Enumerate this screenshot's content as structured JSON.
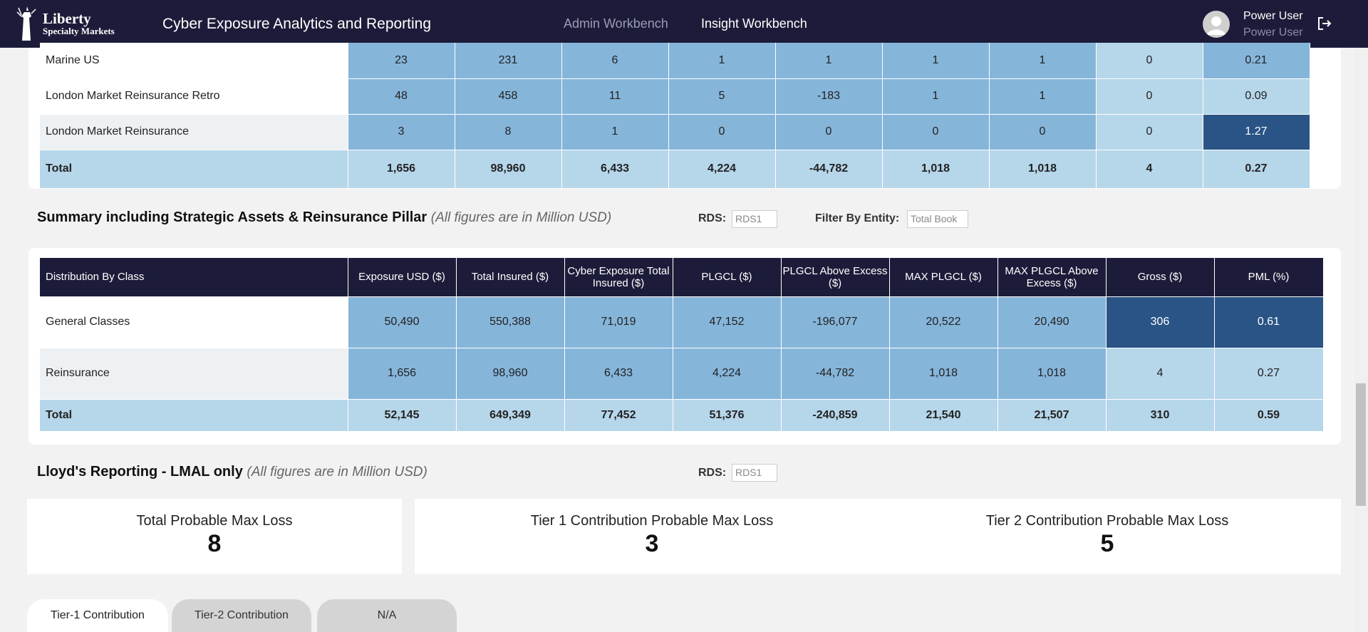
{
  "header": {
    "logo_line1": "Liberty",
    "logo_line2": "Specialty Markets",
    "app_title": "Cyber Exposure Analytics and Reporting",
    "nav": {
      "admin": "Admin Workbench",
      "insight": "Insight Workbench"
    },
    "user_name": "Power User",
    "user_role": "Power User"
  },
  "table1": {
    "rows": [
      {
        "label": "Marine US",
        "values": [
          "23",
          "231",
          "6",
          "1",
          "1",
          "1",
          "1",
          "0",
          "0.21"
        ]
      },
      {
        "label": "London Market Reinsurance Retro",
        "values": [
          "48",
          "458",
          "11",
          "5",
          "-183",
          "1",
          "1",
          "0",
          "0.09"
        ]
      },
      {
        "label": "London Market Reinsurance",
        "values": [
          "3",
          "8",
          "1",
          "0",
          "0",
          "0",
          "0",
          "0",
          "1.27"
        ]
      }
    ],
    "total": {
      "label": "Total",
      "values": [
        "1,656",
        "98,960",
        "6,433",
        "4,224",
        "-44,782",
        "1,018",
        "1,018",
        "4",
        "0.27"
      ]
    }
  },
  "summary": {
    "title": "Summary including Strategic Assets & Reinsurance Pillar",
    "note": "(All figures are in Million USD)",
    "rds_label": "RDS:",
    "rds_value": "RDS1",
    "entity_label": "Filter By Entity:",
    "entity_value": "Total Book"
  },
  "table2": {
    "headers": [
      "Distribution By Class",
      "Exposure USD ($)",
      "Total Insured ($)",
      "Cyber Exposure Total Insured ($)",
      "PLGCL ($)",
      "PLGCL Above Excess ($)",
      "MAX PLGCL ($)",
      "MAX PLGCL Above Excess ($)",
      "Gross ($)",
      "PML (%)"
    ],
    "rows": [
      {
        "label": "General Classes",
        "values": [
          "50,490",
          "550,388",
          "71,019",
          "47,152",
          "-196,077",
          "20,522",
          "20,490",
          "306",
          "0.61"
        ]
      },
      {
        "label": "Reinsurance",
        "values": [
          "1,656",
          "98,960",
          "6,433",
          "4,224",
          "-44,782",
          "1,018",
          "1,018",
          "4",
          "0.27"
        ]
      }
    ],
    "total": {
      "label": "Total",
      "values": [
        "52,145",
        "649,349",
        "77,452",
        "51,376",
        "-240,859",
        "21,540",
        "21,507",
        "310",
        "0.59"
      ]
    }
  },
  "lloyds": {
    "title": "Lloyd's Reporting - LMAL only",
    "note": "(All figures are in Million USD)",
    "rds_label": "RDS:",
    "rds_value": "RDS1",
    "kpis": [
      {
        "title": "Total Probable Max Loss",
        "value": "8"
      },
      {
        "title": "Tier 1 Contribution Probable Max Loss",
        "value": "3"
      },
      {
        "title": "Tier 2 Contribution Probable Max Loss",
        "value": "5"
      }
    ]
  },
  "bottom_tabs": [
    "Tier-1 Contribution",
    "Tier-2 Contribution",
    "N/A"
  ],
  "colors": {
    "header_bg": "#1c1c3a",
    "active_tab": "#6a3cf0",
    "cell_mid": "#86b5da",
    "cell_light": "#b6d6ea",
    "cell_dark": "#2a5486"
  }
}
